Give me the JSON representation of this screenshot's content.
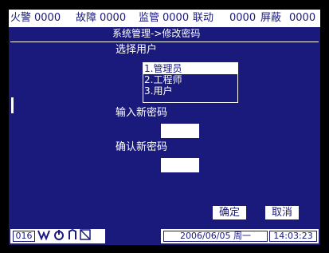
{
  "topbar": {
    "fire_label": "火警",
    "fire_count": "0000",
    "fault_label": "故障",
    "fault_count": "0000",
    "supervise_label": "监管",
    "supervise_count": "0000",
    "linkage_label": "联动",
    "linkage_count": "0000",
    "shield_label": "屏蔽",
    "shield_count": "0000"
  },
  "subtitle": "系统管理->修改密码",
  "select_user": {
    "label": "选择用户",
    "options": [
      "1.管理员",
      "2.工程师",
      "3.用户"
    ],
    "selected_index": 0
  },
  "new_password": {
    "label": "输入新密码",
    "value": ""
  },
  "confirm_password": {
    "label": "确认新密码",
    "value": ""
  },
  "buttons": {
    "ok": "确定",
    "cancel": "取消"
  },
  "status": {
    "code": "016",
    "icons": [
      "wifi-icon",
      "power-icon",
      "battery-icon",
      "slash-icon"
    ],
    "date": "2006/06/05 周一",
    "time": "14:03:23"
  },
  "colors": {
    "background": "#1a1a7c",
    "foreground": "#ffffff"
  }
}
